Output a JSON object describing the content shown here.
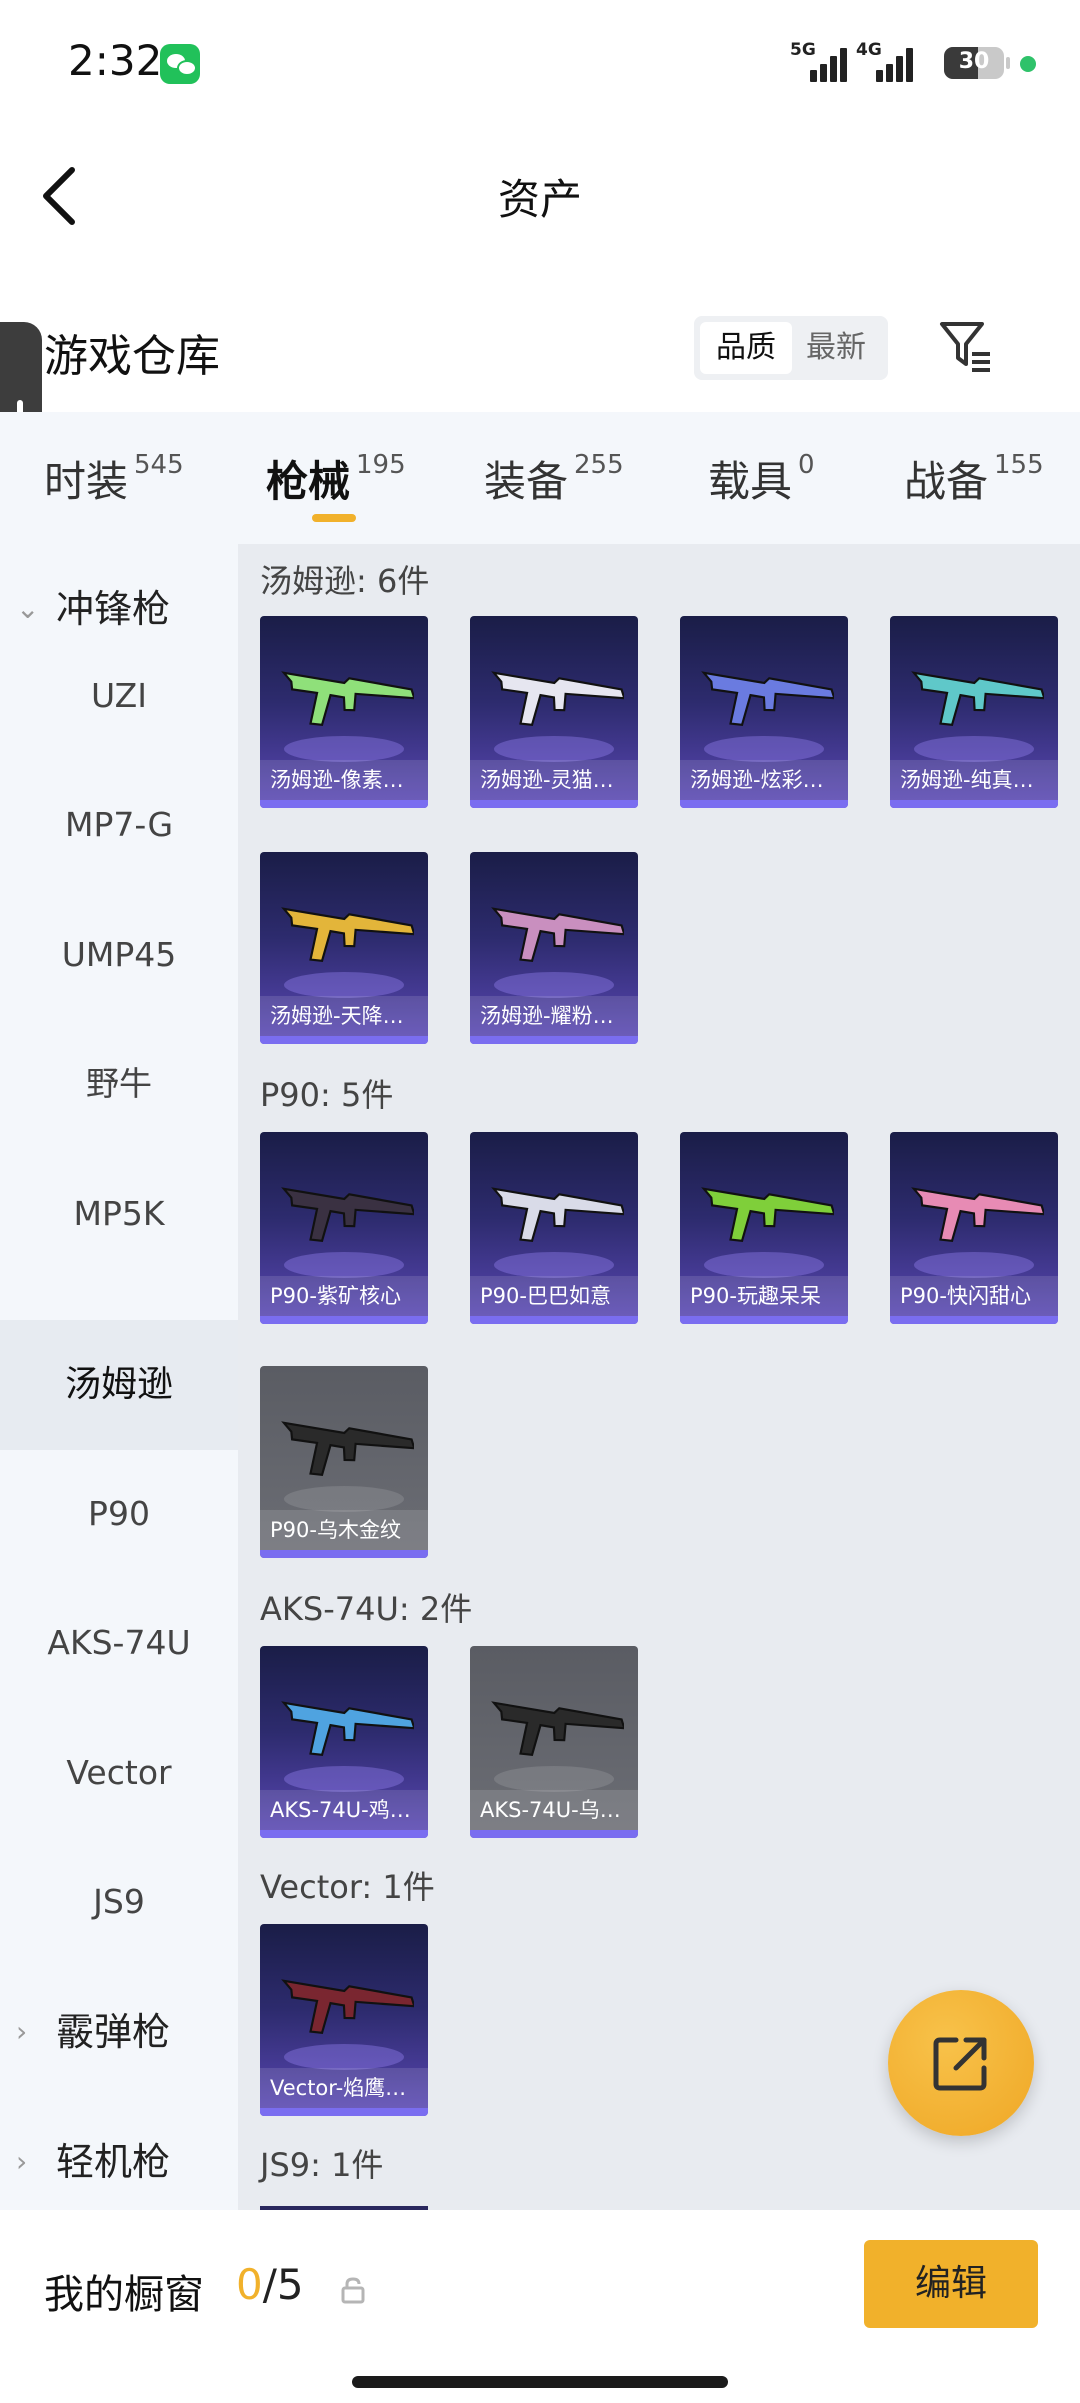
{
  "status": {
    "time": "2:32",
    "signal1": "5G",
    "signal2": "4G",
    "battery": "30"
  },
  "header": {
    "title": "资产"
  },
  "warehouse": {
    "title": "游戏仓库",
    "sort_options": [
      "品质",
      "最新"
    ]
  },
  "tabs": [
    {
      "label": "时装",
      "count": "545"
    },
    {
      "label": "枪械",
      "count": "195"
    },
    {
      "label": "装备",
      "count": "255"
    },
    {
      "label": "载具",
      "count": "0"
    },
    {
      "label": "战备",
      "count": "155"
    }
  ],
  "categories": [
    {
      "label": "冲锋枪",
      "group": true,
      "expanded": true
    },
    {
      "label": "UZI"
    },
    {
      "label": "MP7-G"
    },
    {
      "label": "UMP45"
    },
    {
      "label": "野牛"
    },
    {
      "label": "MP5K"
    },
    {
      "label": "汤姆逊",
      "selected": true
    },
    {
      "label": "P90"
    },
    {
      "label": "AKS-74U"
    },
    {
      "label": "Vector"
    },
    {
      "label": "JS9"
    },
    {
      "label": "霰弹枪",
      "group": true,
      "expanded": false
    },
    {
      "label": "轻机枪",
      "group": true,
      "expanded": false
    }
  ],
  "sections": [
    {
      "title": "汤姆逊: 6件",
      "items": [
        {
          "name": "汤姆逊-像素…",
          "color": "#8fe07a"
        },
        {
          "name": "汤姆逊-灵猫…",
          "color": "#e6e6f0"
        },
        {
          "name": "汤姆逊-炫彩…",
          "color": "#6a7be0"
        },
        {
          "name": "汤姆逊-纯真…",
          "color": "#5fc8c9"
        },
        {
          "name": "汤姆逊-天降…",
          "color": "#e3b53a"
        },
        {
          "name": "汤姆逊-耀粉…",
          "color": "#c98fbf"
        }
      ]
    },
    {
      "title": "P90: 5件",
      "items": [
        {
          "name": "P90-紫矿核心",
          "color": "#3a3142"
        },
        {
          "name": "P90-巴巴如意",
          "color": "#d9dbe8"
        },
        {
          "name": "P90-玩趣呆呆",
          "color": "#7fcf3a"
        },
        {
          "name": "P90-快闪甜心",
          "color": "#e78bb4"
        },
        {
          "name": "P90-乌木金纹",
          "color": "#2a2a2a",
          "gray": true
        }
      ]
    },
    {
      "title": "AKS-74U: 2件",
      "items": [
        {
          "name": "AKS-74U-鸡…",
          "color": "#4fa3e0"
        },
        {
          "name": "AKS-74U-乌…",
          "color": "#2a2a2a",
          "gray": true
        }
      ]
    },
    {
      "title": "Vector: 1件",
      "items": [
        {
          "name": "Vector-焰鹰…",
          "color": "#7a2630"
        }
      ]
    },
    {
      "title": "JS9: 1件",
      "items": []
    }
  ],
  "showcase": {
    "label": "我的橱窗",
    "current": "0",
    "separator": "/",
    "max": "5"
  },
  "edit_label": "编辑",
  "colors": {
    "accent": "#f1b12b",
    "card_purple": "#5b48b6",
    "status_green": "#2fc26a"
  }
}
